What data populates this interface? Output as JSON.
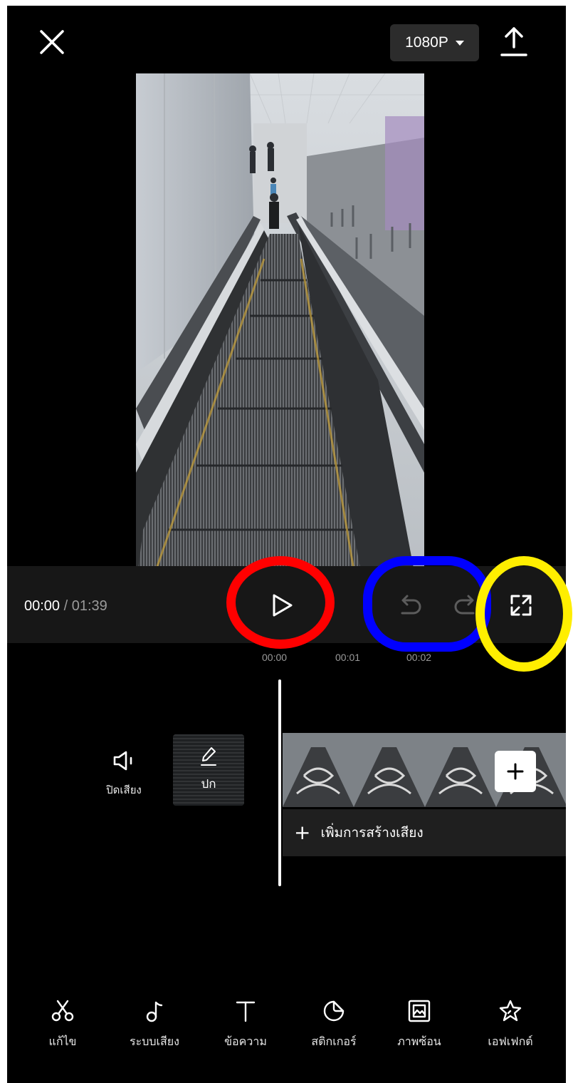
{
  "header": {
    "resolution_label": "1080P"
  },
  "playback": {
    "current_time": "00:00",
    "total_time": " / 01:39"
  },
  "timeline": {
    "ticks": [
      "00:00",
      "00:01",
      "00:02"
    ],
    "mute_label": "ปิดเสียง",
    "cover_label": "ปก",
    "add_audio_label": "เพิ่มการสร้างเสียง"
  },
  "toolbar": {
    "items": [
      {
        "label": "แก้ไข",
        "icon": "scissors-icon"
      },
      {
        "label": "ระบบเสียง",
        "icon": "music-note-icon"
      },
      {
        "label": "ข้อความ",
        "icon": "text-icon"
      },
      {
        "label": "สติกเกอร์",
        "icon": "sticker-icon"
      },
      {
        "label": "ภาพซ้อน",
        "icon": "overlay-icon"
      },
      {
        "label": "เอฟเฟกต์",
        "icon": "effects-star-icon"
      }
    ]
  },
  "colors": {
    "background": "#000000",
    "playbar": "#171717",
    "annotation_red": "#ff0000",
    "annotation_blue": "#0000ff",
    "annotation_yellow": "#ffee00"
  }
}
